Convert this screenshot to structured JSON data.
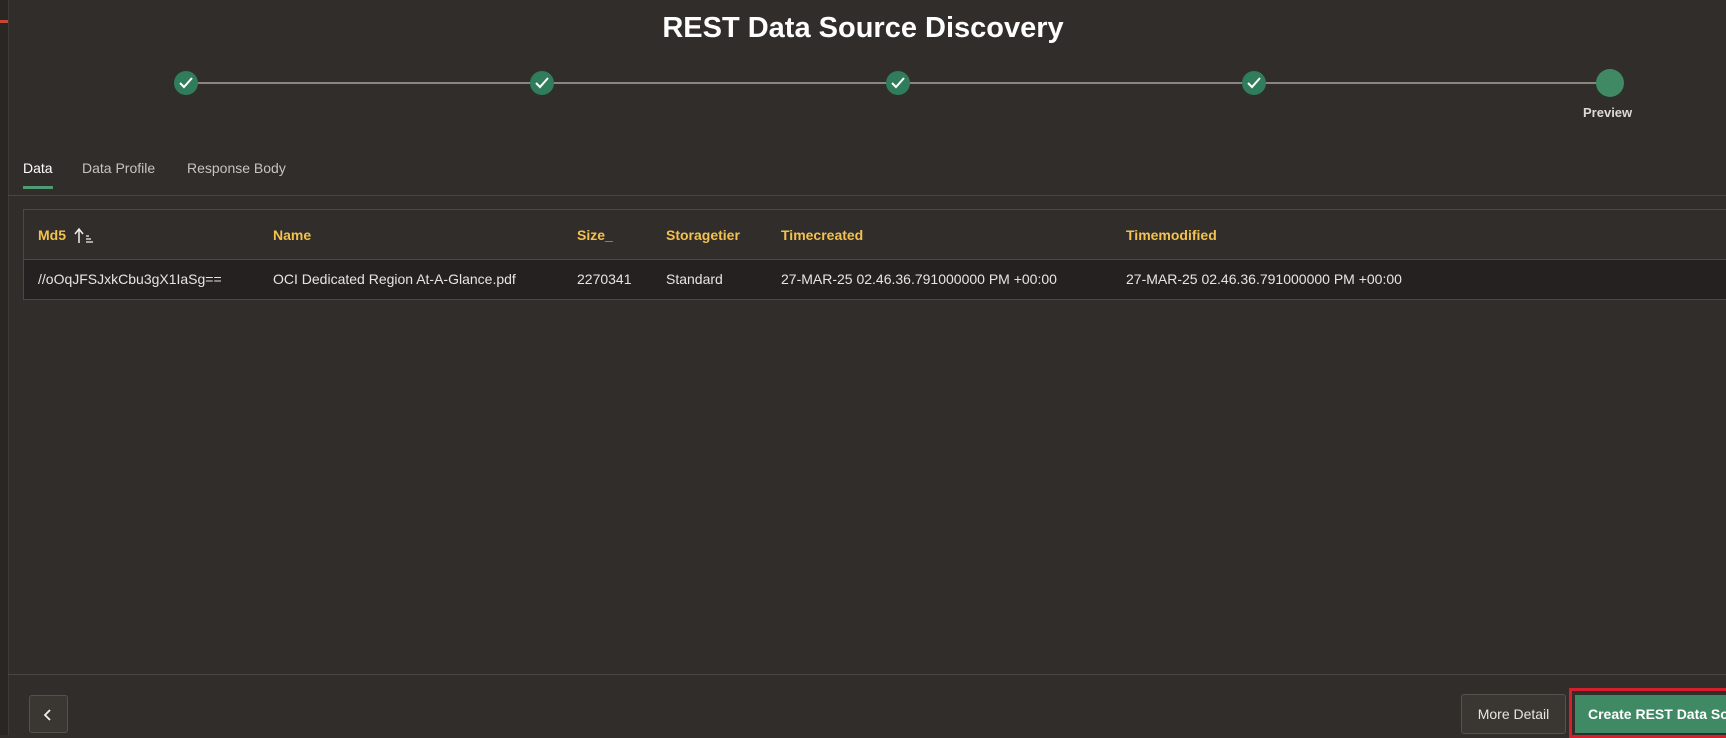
{
  "dialog": {
    "title": "REST Data Source Discovery"
  },
  "wizard": {
    "steps": [
      {
        "status": "complete",
        "label": ""
      },
      {
        "status": "complete",
        "label": ""
      },
      {
        "status": "complete",
        "label": ""
      },
      {
        "status": "complete",
        "label": ""
      },
      {
        "status": "current",
        "label": "Preview"
      }
    ]
  },
  "tabs": [
    {
      "label": "Data",
      "active": true
    },
    {
      "label": "Data Profile",
      "active": false
    },
    {
      "label": "Response Body",
      "active": false
    }
  ],
  "grid": {
    "columns": [
      "Md5",
      "Name",
      "Size_",
      "Storagetier",
      "Timecreated",
      "Timemodified"
    ],
    "sort": {
      "column": "Md5",
      "direction": "ascending"
    },
    "rows": [
      [
        "//oOqJFSJxkCbu3gX1IaSg==",
        "OCI Dedicated Region At-A-Glance.pdf",
        "2270341",
        "Standard",
        "27-MAR-25 02.46.36.791000000 PM +00:00",
        "27-MAR-25 02.46.36.791000000 PM +00:00"
      ]
    ]
  },
  "footer": {
    "more_detail_label": "More Detail",
    "create_label": "Create REST Data Source"
  },
  "colors": {
    "background": "#312d2a",
    "accent_green": "#3f8a64",
    "header_text": "#f2c14e",
    "highlight_red": "#d51f2d"
  }
}
